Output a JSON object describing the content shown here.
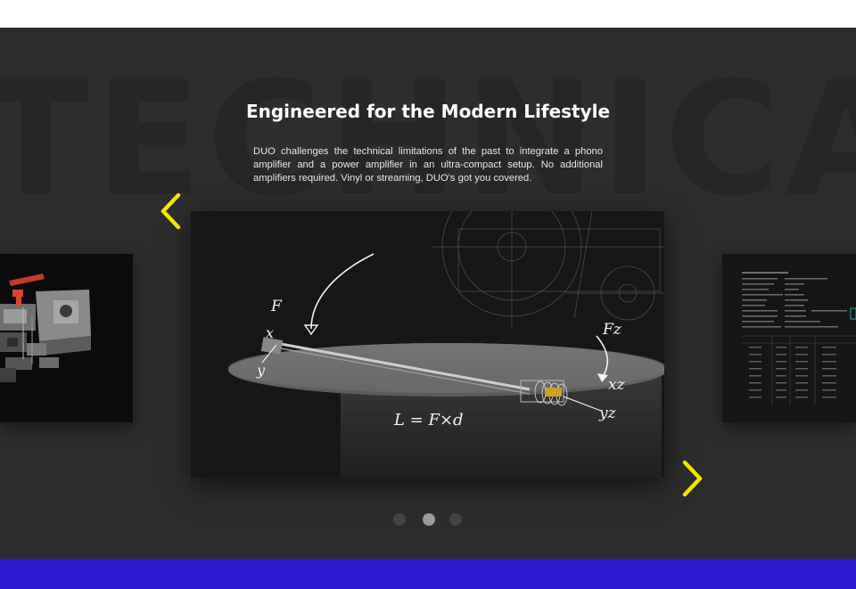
{
  "hero": {
    "background_word": "TECHNICAL",
    "title": "Engineered for the Modern Lifestyle",
    "description": "DUO challenges the technical limitations of the past to integrate a phono amplifier and a power amplifier in an ultra-compact setup. No additional amplifiers required. Vinyl or streaming, DUO’s got you covered."
  },
  "carousel": {
    "prev_icon": "chevron-left-icon",
    "next_icon": "chevron-right-icon",
    "arrow_color": "#f2e600",
    "slides": [
      {
        "name": "slide-exploded-parts"
      },
      {
        "name": "slide-turntable-sketch",
        "active": true
      },
      {
        "name": "slide-spec-table"
      }
    ],
    "sketch_labels": {
      "f": "F",
      "x": "x",
      "y": "y",
      "fz": "Fz",
      "xz": "xz",
      "yz": "yz",
      "formula": "L = F×d"
    },
    "pagination": {
      "count": 3,
      "active_index": 1
    }
  },
  "colors": {
    "section_bg": "#2d2d2d",
    "accent_yellow": "#f2e600",
    "footer_band": "#2e17d3"
  }
}
